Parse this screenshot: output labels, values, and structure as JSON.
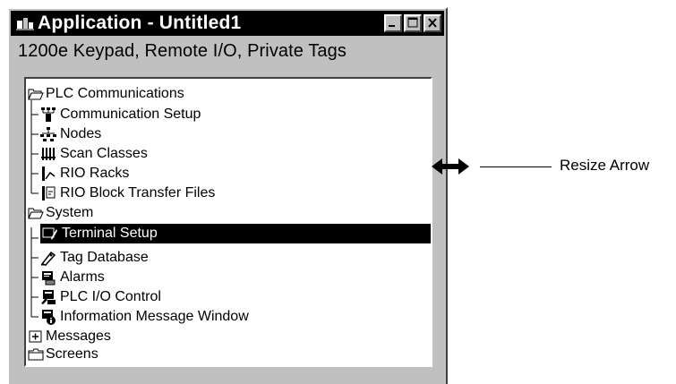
{
  "window": {
    "title": "Application - Untitled1",
    "subtitle": "1200e Keypad, Remote I/O, Private Tags"
  },
  "tree": {
    "plc_comm": {
      "label": "PLC Communications",
      "icon": "folder-open-icon",
      "children": [
        {
          "label": "Communication Setup",
          "icon": "network-icon"
        },
        {
          "label": "Nodes",
          "icon": "nodes-icon"
        },
        {
          "label": "Scan Classes",
          "icon": "scan-classes-icon"
        },
        {
          "label": "RIO Racks",
          "icon": "rio-rack-icon"
        },
        {
          "label": "RIO Block Transfer Files",
          "icon": "block-transfer-icon"
        }
      ]
    },
    "system": {
      "label": "System",
      "icon": "folder-open-icon",
      "children": [
        {
          "label": "Terminal Setup",
          "icon": "terminal-icon",
          "selected": true
        },
        {
          "label": "Tag Database",
          "icon": "tag-icon"
        },
        {
          "label": "Alarms",
          "icon": "alarm-icon"
        },
        {
          "label": "PLC I/O Control",
          "icon": "io-control-icon"
        },
        {
          "label": "Information Message Window",
          "icon": "info-window-icon"
        }
      ]
    },
    "messages": {
      "label": "Messages",
      "icon": "plus-box-icon"
    },
    "screens": {
      "label": "Screens",
      "icon": "folder-closed-icon"
    }
  },
  "annotation": {
    "label": "Resize Arrow",
    "icon": "double-arrow-icon"
  },
  "colors": {
    "titlebar": "#000000",
    "window_face": "#c0c0c0",
    "selection": "#000000"
  }
}
